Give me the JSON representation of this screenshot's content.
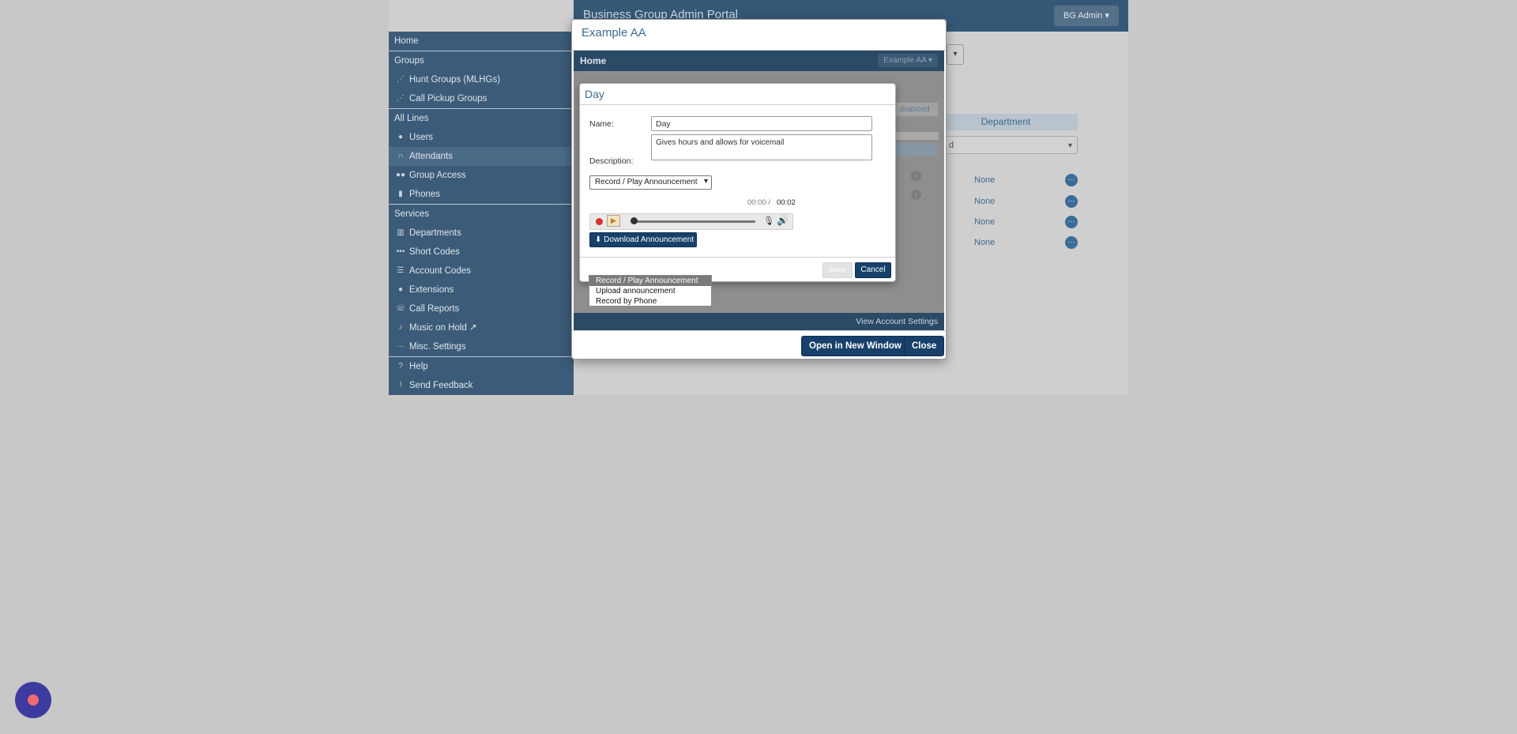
{
  "app": {
    "portal_title": "Business Group Admin Portal",
    "user_menu_label": "BG Admin ▾"
  },
  "sidebar": {
    "sections": [
      {
        "header": "Home"
      },
      {
        "header": "Groups",
        "items": [
          {
            "label": "Hunt Groups (MLHGs)",
            "icon": "hunt-groups-icon"
          },
          {
            "label": "Call Pickup Groups",
            "icon": "call-pickup-icon"
          }
        ]
      },
      {
        "header": "All Lines",
        "items": [
          {
            "label": "Users",
            "icon": "user-icon"
          },
          {
            "label": "Attendants",
            "icon": "headset-icon",
            "active": true
          },
          {
            "label": "Group Access",
            "icon": "group-icon"
          },
          {
            "label": "Phones",
            "icon": "phones-icon"
          }
        ]
      },
      {
        "header": "Services",
        "items": [
          {
            "label": "Departments",
            "icon": "departments-icon"
          },
          {
            "label": "Short Codes",
            "icon": "short-codes-icon"
          },
          {
            "label": "Account Codes",
            "icon": "list-icon"
          },
          {
            "label": "Extensions",
            "icon": "extensions-icon"
          },
          {
            "label": "Call Reports",
            "icon": "phone-icon"
          },
          {
            "label": "Music on Hold ↗",
            "icon": "music-icon"
          },
          {
            "label": "Misc. Settings",
            "icon": "ellipsis-icon"
          }
        ]
      },
      {
        "items": [
          {
            "label": "Help",
            "icon": "question-icon"
          },
          {
            "label": "Send Feedback",
            "icon": "exclamation-icon"
          }
        ]
      }
    ]
  },
  "background": {
    "dept_header": "Department",
    "dept_select_value": "d",
    "rows": [
      "None",
      "None",
      "None",
      "None"
    ]
  },
  "outer_modal": {
    "title": "Example AA",
    "frame_home": "Home",
    "frame_dropdown": "Example AA ▾",
    "advanced_fragment": "dvanced",
    "view_account_settings": "View Account Settings",
    "open_new_window": "Open in New Window",
    "close": "Close"
  },
  "dialog": {
    "title": "Day",
    "name_label": "Name:",
    "name_value": "Day",
    "description_label": "Description:",
    "description_value": "Gives hours and allows for voicemail",
    "announcement_select": "Record / Play Announcement",
    "time_current": "00:00 /",
    "time_duration": "00:02",
    "download_label": "Download Announcement",
    "save_label": "Save",
    "cancel_label": "Cancel",
    "options": [
      "Record / Play Announcement",
      "Upload announcement",
      "Record by Phone"
    ]
  },
  "colors": {
    "sidebar_bg": "#3b5b78",
    "brand_dark": "#17406a",
    "title_blue": "#3e6a93",
    "record_red": "#d43232"
  }
}
